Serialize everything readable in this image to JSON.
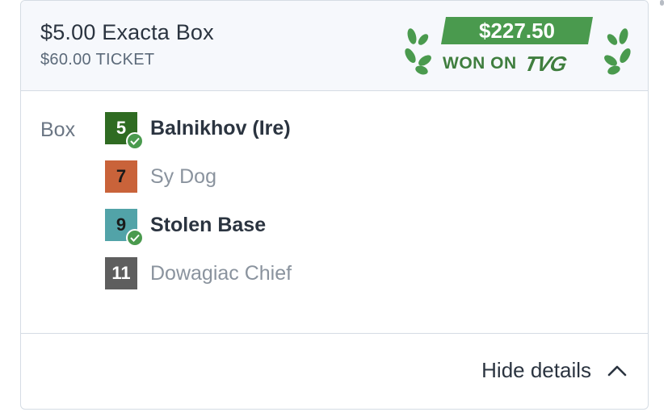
{
  "bet": {
    "title": "$5.00 Exacta Box",
    "ticket": "$60.00 TICKET"
  },
  "badge": {
    "amount": "$227.50",
    "won_text": "WON ON",
    "brand": "TVG",
    "color": "#4a9a4e",
    "text_color": "#3f7e3e"
  },
  "selection": {
    "label": "Box",
    "runners": [
      {
        "number": "5",
        "name": "Balnikhov (Ire)",
        "saddle_bg": "#2f6b22",
        "saddle_fg": "#ffffff",
        "winner": true
      },
      {
        "number": "7",
        "name": "Sy Dog",
        "saddle_bg": "#c9633a",
        "saddle_fg": "#1a1a1a",
        "winner": false
      },
      {
        "number": "9",
        "name": "Stolen Base",
        "saddle_bg": "#52a3a8",
        "saddle_fg": "#1a1a1a",
        "winner": true
      },
      {
        "number": "11",
        "name": "Dowagiac Chief",
        "saddle_bg": "#5e5e5e",
        "saddle_fg": "#ffffff",
        "winner": false
      }
    ]
  },
  "footer": {
    "toggle_label": "Hide details",
    "toggle_icon": "chevron-up-icon"
  }
}
